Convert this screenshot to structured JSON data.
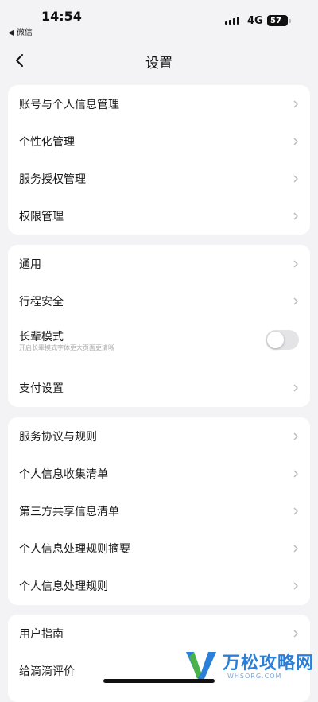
{
  "status_bar": {
    "time": "14:54",
    "back_app": "◀ 微信",
    "network": "4G",
    "battery": "57"
  },
  "nav": {
    "title": "设置"
  },
  "groups": [
    {
      "items": [
        {
          "label": "账号与个人信息管理"
        },
        {
          "label": "个性化管理"
        },
        {
          "label": "服务授权管理"
        },
        {
          "label": "权限管理"
        }
      ]
    },
    {
      "items": [
        {
          "label": "通用"
        },
        {
          "label": "行程安全"
        },
        {
          "label": "长辈模式",
          "subtitle": "开启长辈模式字体更大页面更清晰",
          "toggle": false
        },
        {
          "label": "支付设置"
        }
      ]
    },
    {
      "items": [
        {
          "label": "服务协议与规则"
        },
        {
          "label": "个人信息收集清单"
        },
        {
          "label": "第三方共享信息清单"
        },
        {
          "label": "个人信息处理规则摘要"
        },
        {
          "label": "个人信息处理规则"
        }
      ]
    },
    {
      "items": [
        {
          "label": "用户指南"
        },
        {
          "label": "给滴滴评价"
        }
      ]
    }
  ],
  "watermark": {
    "text": "万松攻略网",
    "url": "WHSORG.COM"
  },
  "colors": {
    "background": "#f3f3f5",
    "card": "#ffffff",
    "chevron": "#b8b8b8",
    "watermark": "#2b7fd8"
  }
}
